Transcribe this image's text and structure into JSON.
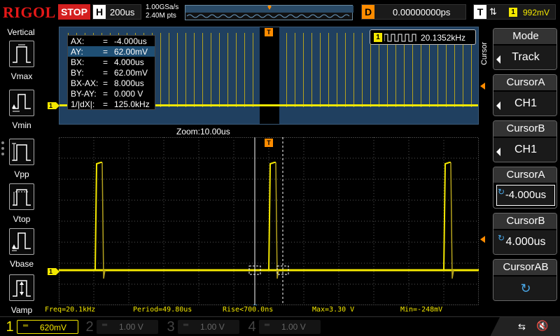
{
  "topbar": {
    "brand": "RIGOL",
    "run_state": "STOP",
    "horizontal_label": "H",
    "timebase": "200us",
    "sample_rate": "1.00GSa/s",
    "memory_depth": "2.40M pts",
    "delay_label": "D",
    "delay_value": "0.00000000ps",
    "trigger_label": "T",
    "trigger_channel": "1",
    "trigger_level": "992mV"
  },
  "left_menu": {
    "title": "Vertical",
    "items": [
      {
        "label": "Vmax",
        "icon": "vmax-icon"
      },
      {
        "label": "Vmin",
        "icon": "vmin-icon"
      },
      {
        "label": "Vpp",
        "icon": "vpp-icon"
      },
      {
        "label": "Vtop",
        "icon": "vtop-icon"
      },
      {
        "label": "Vbase",
        "icon": "vbase-icon"
      },
      {
        "label": "Vamp",
        "icon": "vamp-icon"
      }
    ]
  },
  "cursor_readout": {
    "rows": [
      {
        "key": "AX:",
        "eq": "=",
        "value": "-4.000us"
      },
      {
        "key": "AY:",
        "eq": "=",
        "value": "62.00mV"
      },
      {
        "key": "BX:",
        "eq": "=",
        "value": "4.000us"
      },
      {
        "key": "BY:",
        "eq": "=",
        "value": "62.00mV"
      },
      {
        "key": "BX-AX:",
        "eq": "=",
        "value": "8.000us"
      },
      {
        "key": "BY-AY:",
        "eq": "=",
        "value": "0.000 V"
      },
      {
        "key": "1/|dX|:",
        "eq": "=",
        "value": "125.0kHz"
      }
    ]
  },
  "frequency_counter": {
    "channel": "1",
    "value": "20.1352kHz"
  },
  "zoom": {
    "label": "Zoom:10.00us"
  },
  "markers": {
    "channel1": "1",
    "trigger": "T"
  },
  "measurements": {
    "freq": "Freq=20.1kHz",
    "period": "Period=49.80us",
    "rise": "Rise<700.0ns",
    "max": "Max=3.30 V",
    "min": "Min=-248mV"
  },
  "right_menu": {
    "vertical_title": "Cursor",
    "softkeys": [
      {
        "title": "Mode",
        "value": "Track"
      },
      {
        "title": "CursorA",
        "value": "CH1"
      },
      {
        "title": "CursorB",
        "value": "CH1"
      },
      {
        "title": "CursorA",
        "value": "-4.000us"
      },
      {
        "title": "CursorB",
        "value": "4.000us"
      },
      {
        "title": "CursorAB",
        "value": ""
      }
    ]
  },
  "channels": [
    {
      "number": "1",
      "scale": "620mV",
      "color": "#f4e800"
    },
    {
      "number": "2",
      "scale": "1.00 V",
      "color": "#00c0c0"
    },
    {
      "number": "3",
      "scale": "1.00 V",
      "color": "#c000c0"
    },
    {
      "number": "4",
      "scale": "1.00 V",
      "color": "#1e6ee8"
    }
  ],
  "colors": {
    "ch1": "#f4e800",
    "trigger": "#ff8c00",
    "stop": "#d41f1f",
    "brand": "#e51818",
    "overview_bg": "#204060"
  }
}
